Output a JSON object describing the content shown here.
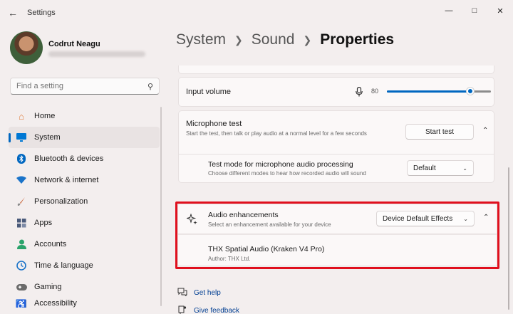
{
  "window": {
    "title": "Settings",
    "back_icon": "back-arrow-icon",
    "controls": [
      "minimize-icon",
      "maximize-icon",
      "close-icon"
    ]
  },
  "profile": {
    "name": "Codrut Neagu"
  },
  "search": {
    "placeholder": "Find a setting"
  },
  "sidebar": {
    "items": [
      {
        "label": "Home",
        "icon": "home-icon",
        "color": "#e07b39"
      },
      {
        "label": "System",
        "icon": "system-monitor-icon",
        "color": "#0078d4",
        "selected": true
      },
      {
        "label": "Bluetooth & devices",
        "icon": "bluetooth-icon",
        "color": "#0067c0"
      },
      {
        "label": "Network & internet",
        "icon": "wifi-icon",
        "color": "#1a73c9"
      },
      {
        "label": "Personalization",
        "icon": "brush-icon",
        "color": "#c8653a"
      },
      {
        "label": "Apps",
        "icon": "apps-icon",
        "color": "#4a5a7a"
      },
      {
        "label": "Accounts",
        "icon": "accounts-icon",
        "color": "#2aa36b"
      },
      {
        "label": "Time & language",
        "icon": "globe-clock-icon",
        "color": "#1a73c9"
      },
      {
        "label": "Gaming",
        "icon": "gamepad-icon",
        "color": "#6b6b6b"
      },
      {
        "label": "Accessibility",
        "icon": "accessibility-icon",
        "color": "#1a73c9"
      }
    ]
  },
  "breadcrumb": {
    "items": [
      "System",
      "Sound",
      "Properties"
    ]
  },
  "input_volume": {
    "label": "Input volume",
    "value": "80",
    "level": 80
  },
  "mic_test": {
    "label": "Microphone test",
    "description": "Start the test, then talk or play audio at a normal level for a few seconds",
    "button": "Start test"
  },
  "test_mode": {
    "label": "Test mode for microphone audio processing",
    "description": "Choose different modes to hear how recorded audio will sound",
    "value": "Default"
  },
  "enhancements": {
    "label": "Audio enhancements",
    "description": "Select an enhancement available for your device",
    "value": "Device Default Effects",
    "highlight_color": "#e0101e"
  },
  "thx": {
    "name": "THX Spatial Audio (Kraken V4 Pro)",
    "author": "Author: THX Ltd."
  },
  "links": [
    {
      "label": "Get help",
      "icon": "help-icon"
    },
    {
      "label": "Give feedback",
      "icon": "feedback-icon"
    }
  ],
  "colors": {
    "accent": "#0067c0",
    "background": "#f3eeee"
  }
}
